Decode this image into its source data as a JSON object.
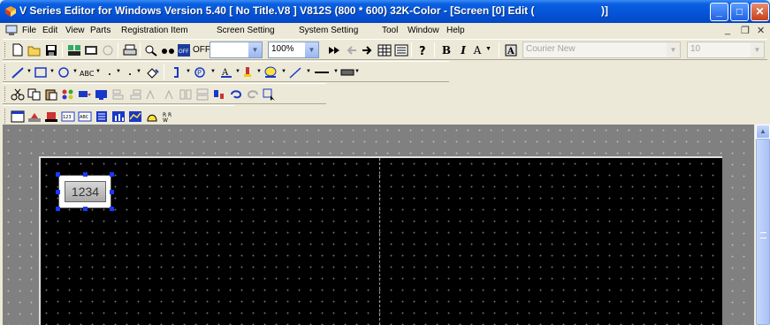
{
  "window": {
    "title": "V Series Editor for Windows Version 5.40 [ No Title.V8 ] V812S (800 * 600) 32K-Color - [Screen [0] Edit (",
    "title_tail": ")]",
    "minimize": "_",
    "maximize": "□",
    "close": "✕"
  },
  "menu": {
    "items": [
      "File",
      "Edit",
      "View",
      "Parts",
      "Registration Item",
      "Screen Setting",
      "System Setting",
      "Tool",
      "Window",
      "Help"
    ],
    "mdi_minimize": "_",
    "mdi_restore": "❐",
    "mdi_close": "✕"
  },
  "toolbar1": {
    "overlap_label": "OFF",
    "zoom_value": "100%",
    "font_name": "Courier New",
    "font_size": "10",
    "bold": "B",
    "italic": "I",
    "text_size": "A"
  },
  "screen": {
    "numeric_display_value": "1234"
  },
  "colors": {
    "title_bar": "#0553d8",
    "workspace": "#808080",
    "canvas": "#000000",
    "handle": "#1a38ff"
  }
}
